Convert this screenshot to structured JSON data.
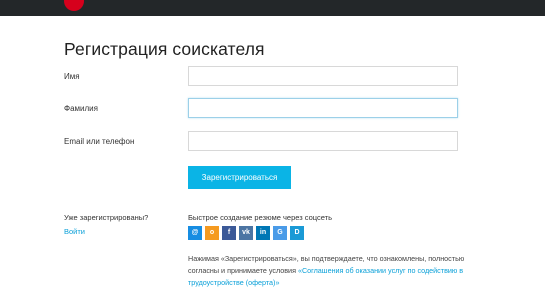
{
  "header": {
    "logo_icon": "red-circle-logo",
    "background": "#232729",
    "logo_color": "#d6001c"
  },
  "page": {
    "title": "Регистрация соискателя"
  },
  "form": {
    "first_name": {
      "label": "Имя",
      "value": ""
    },
    "last_name": {
      "label": "Фамилия",
      "value": ""
    },
    "contact": {
      "label": "Email или телефон",
      "value": ""
    },
    "submit_label": "Зарегистрироваться"
  },
  "login": {
    "question": "Уже зарегистрированы?",
    "link": "Войти"
  },
  "social": {
    "title": "Быстрое создание резюме через соцсеть",
    "buttons": [
      {
        "name": "mailru",
        "glyph": "@",
        "color": "#168de2"
      },
      {
        "name": "odnoklassniki",
        "glyph": "o",
        "color": "#f59a20"
      },
      {
        "name": "facebook",
        "glyph": "f",
        "color": "#3b5998"
      },
      {
        "name": "vkontakte",
        "glyph": "vk",
        "color": "#4c75a3"
      },
      {
        "name": "linkedin",
        "glyph": "in",
        "color": "#0077b5"
      },
      {
        "name": "google",
        "glyph": "G",
        "color": "#4a9be8"
      },
      {
        "name": "d-service",
        "glyph": "D",
        "color": "#1a9ad6"
      }
    ]
  },
  "notice": {
    "text": "Нажимая «Зарегистрироваться», вы подтверждаете, что ознакомлены, полностью согласны и принимаете условия ",
    "link": "«Соглашения об оказании услуг по содействию в трудоустройстве (оферта)»"
  },
  "colors": {
    "accent": "#0ab4e6",
    "link": "#0aa0d8"
  }
}
